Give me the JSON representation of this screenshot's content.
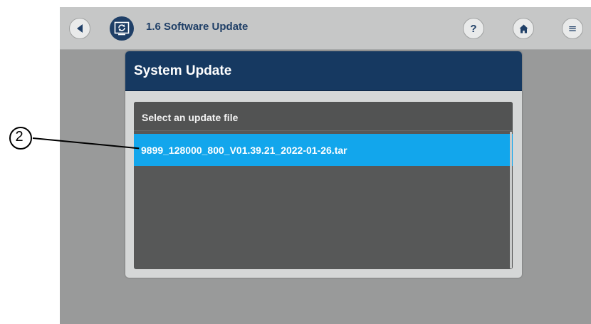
{
  "topbar": {
    "title": "1.6 Software Update",
    "back_icon": "back-arrow-icon",
    "app_icon": "software-update-icon",
    "help_label": "?",
    "home_icon": "home-icon",
    "menu_label": "≡"
  },
  "dialog": {
    "title": "System Update",
    "file_list": {
      "header": "Select an update file",
      "files": [
        {
          "name": "9899_128000_800_V01.39.21_2022-01-26.tar",
          "selected": true
        }
      ]
    }
  },
  "annotation": {
    "callout_number": "2"
  },
  "colors": {
    "screen_bg": "#999a9a",
    "topbar_bg": "#c6c7c7",
    "header_navy": "#163961",
    "panel_dark": "#575858",
    "selected_row": "#12a6ec",
    "accent_navy": "#1f3f67"
  }
}
